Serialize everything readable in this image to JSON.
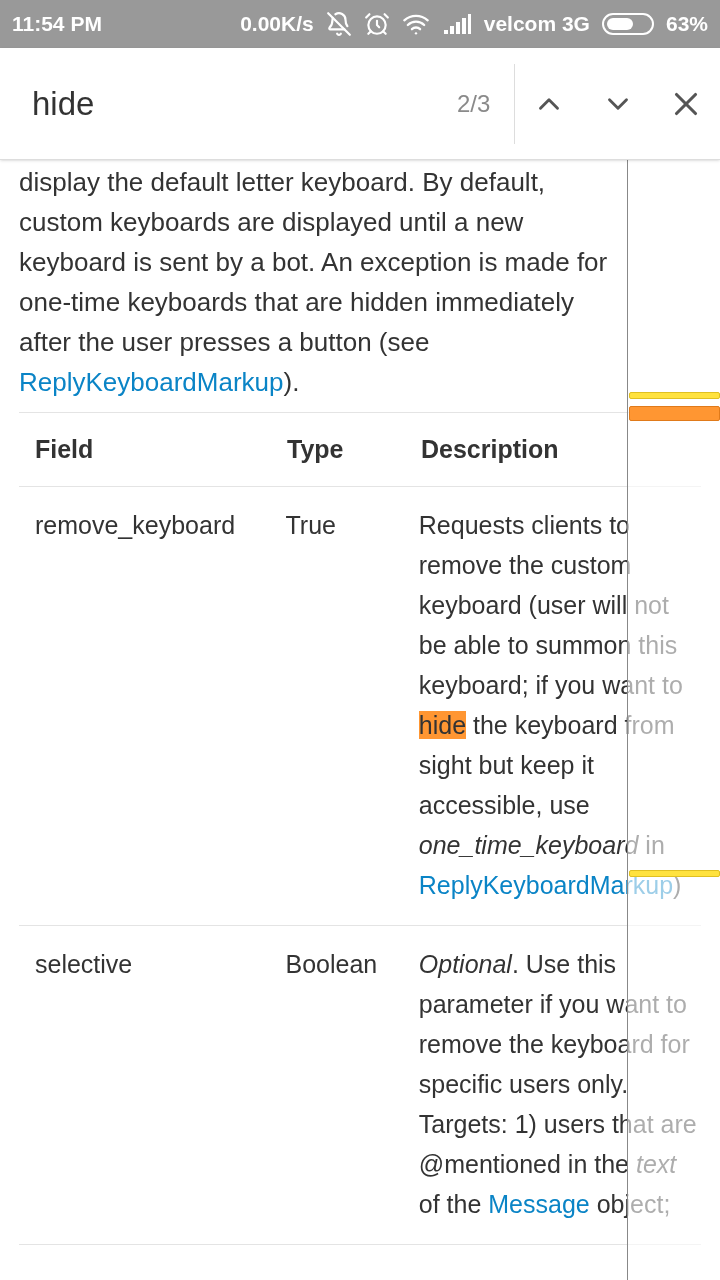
{
  "status_bar": {
    "time": "11:54 PM",
    "speed": "0.00K/s",
    "carrier": "velcom 3G",
    "battery": "63%"
  },
  "find_bar": {
    "query": "hide",
    "count": "2/3"
  },
  "intro": [
    {
      "kind": "text",
      "text": "display the default letter keyboard. By default, custom keyboards are displayed until a new keyboard is sent by a bot. An exception is made for one-time keyboards that are hidden immediately after the user presses a button (see "
    },
    {
      "kind": "link",
      "text": "ReplyKeyboardMarkup"
    },
    {
      "kind": "text",
      "text": ")."
    }
  ],
  "table": {
    "columns": [
      "Field",
      "Type",
      "Description"
    ],
    "rows": [
      {
        "field": "remove_keyboard",
        "type": "True",
        "description": [
          {
            "kind": "text",
            "text": "Requests clients to remove the custom keyboard (user will not be able to summon this keyboard; if you want to "
          },
          {
            "kind": "match",
            "text": "hide"
          },
          {
            "kind": "text",
            "text": " the keyboard from sight but keep it accessible, use "
          },
          {
            "kind": "italic",
            "text": "one_time_keyboard"
          },
          {
            "kind": "text",
            "text": " in "
          },
          {
            "kind": "link",
            "text": "ReplyKeyboardMarkup"
          },
          {
            "kind": "text",
            "text": ")"
          }
        ]
      },
      {
        "field": "selective",
        "type": "Boolean",
        "description": [
          {
            "kind": "italic",
            "text": "Optional"
          },
          {
            "kind": "text",
            "text": ". Use this parameter if you want to remove the keyboard for specific users only. Targets: 1) users that are @mentioned in the "
          },
          {
            "kind": "italic",
            "text": "text"
          },
          {
            "kind": "text",
            "text": " of the "
          },
          {
            "kind": "link",
            "text": "Message"
          },
          {
            "kind": "text",
            "text": " object;"
          }
        ]
      }
    ]
  },
  "match_markers": [
    {
      "selected": false
    },
    {
      "selected": true
    },
    {
      "selected": false
    }
  ]
}
